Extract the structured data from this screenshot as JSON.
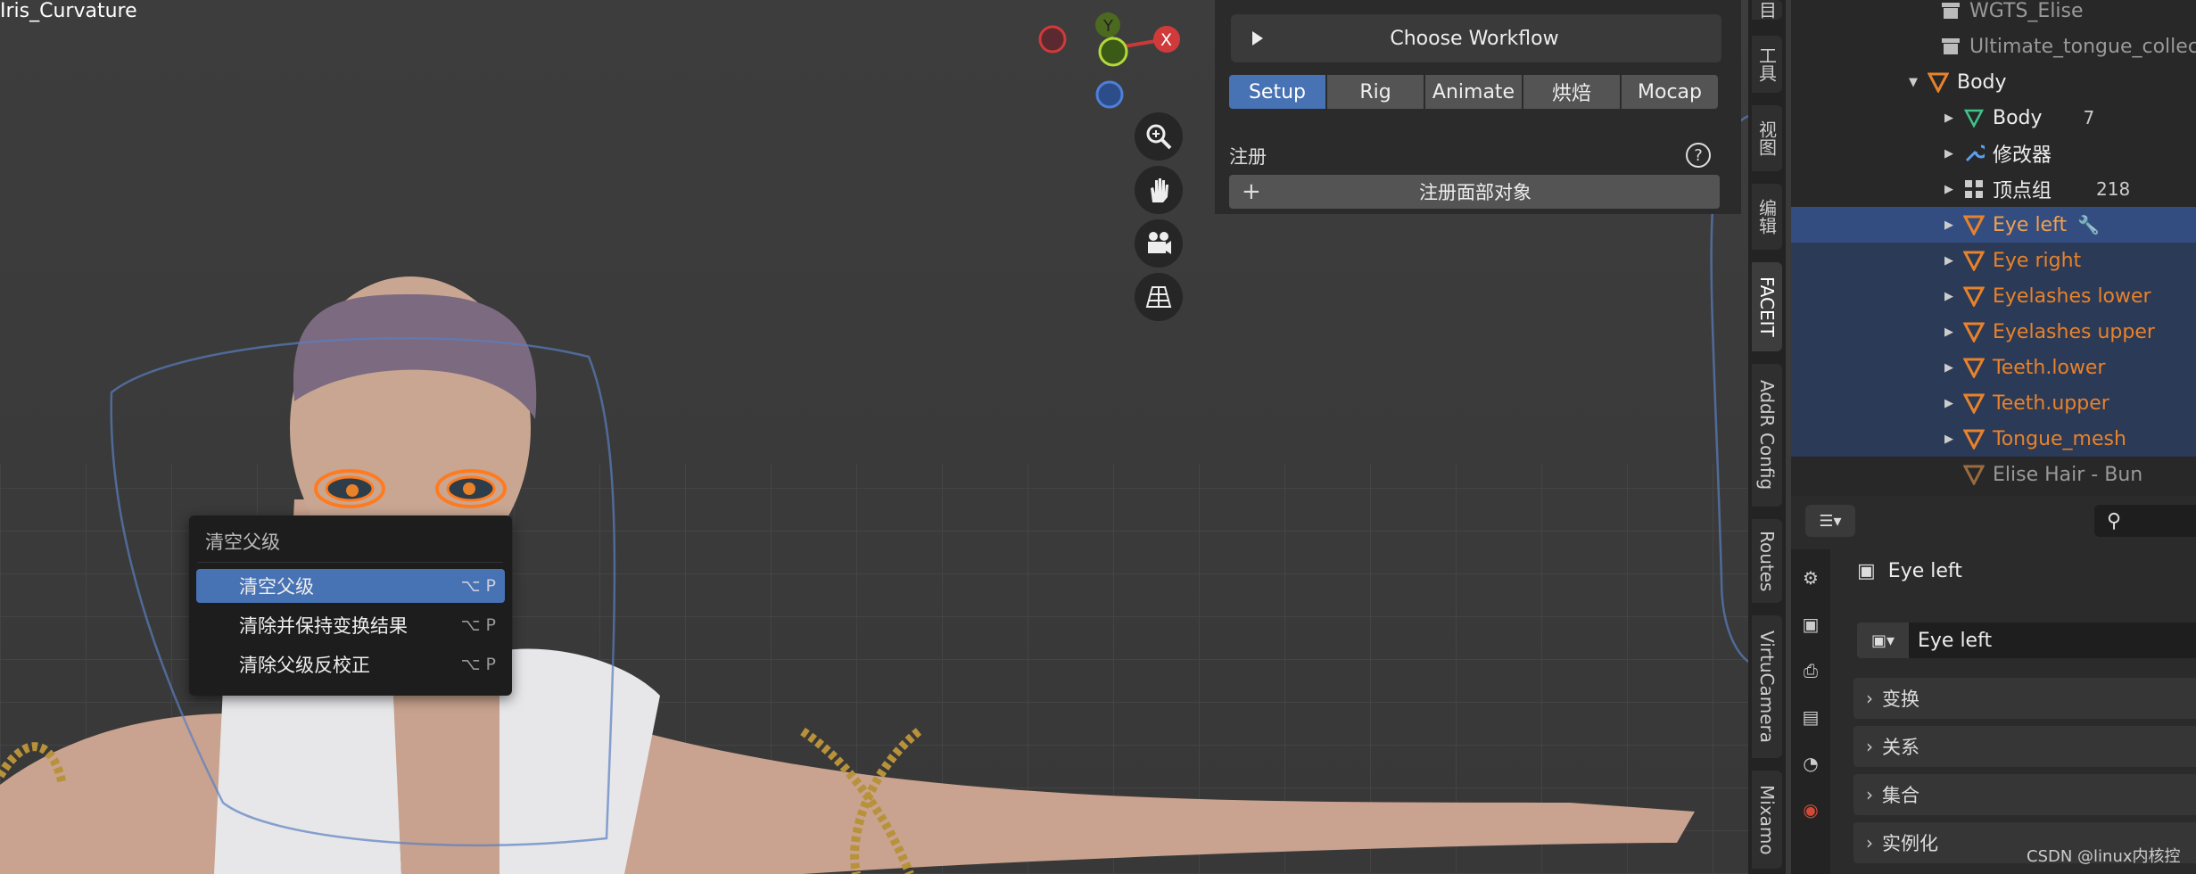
{
  "viewport": {
    "object_name": "Iris_Curvature",
    "gizmo": {
      "x_label": "X",
      "y_label": "Y"
    }
  },
  "nav_icons": [
    "zoom-icon",
    "hand-icon",
    "camera-icon",
    "grid-icon"
  ],
  "faceit": {
    "workflow_label": "Choose Workflow",
    "tabs": [
      "Setup",
      "Rig",
      "Animate",
      "烘焙",
      "Mocap"
    ],
    "active_tab": "Setup",
    "register_label": "注册",
    "help": "?",
    "register_button": "注册面部对象"
  },
  "context_menu": {
    "title": "清空父级",
    "items": [
      {
        "label": "清空父级",
        "shortcut": "⌥ P"
      },
      {
        "label": "清除并保持变换结果",
        "shortcut": "⌥ P"
      },
      {
        "label": "清除父级反校正",
        "shortcut": "⌥ P"
      }
    ]
  },
  "side_tabs": [
    "目",
    "工具",
    "视图",
    "编辑",
    "FACEIT",
    "AddR Config",
    "Routes",
    "VirtuCamera",
    "Mixamo"
  ],
  "outliner": {
    "rows": [
      {
        "name": "WGTS_Elise"
      },
      {
        "name": "Ultimate_tongue_collec"
      },
      {
        "name": "Body"
      },
      {
        "name": "Body",
        "extra": "7"
      },
      {
        "name": "修改器"
      },
      {
        "name": "顶点组",
        "extra": "218"
      },
      {
        "name": "Eye left"
      },
      {
        "name": "Eye right"
      },
      {
        "name": "Eyelashes lower"
      },
      {
        "name": "Eyelashes upper"
      },
      {
        "name": "Teeth.lower"
      },
      {
        "name": "Teeth.upper"
      },
      {
        "name": "Tongue_mesh"
      },
      {
        "name": "Elise Hair - Bun"
      }
    ]
  },
  "properties": {
    "object_header": "Eye left",
    "object_field": "Eye left",
    "sections": [
      "变换",
      "关系",
      "集合",
      "实例化"
    ]
  },
  "watermark": "CSDN @linux内核控",
  "colors": {
    "accent": "#4772b3",
    "orange": "#e8822b",
    "panel": "#2b2b2b"
  }
}
